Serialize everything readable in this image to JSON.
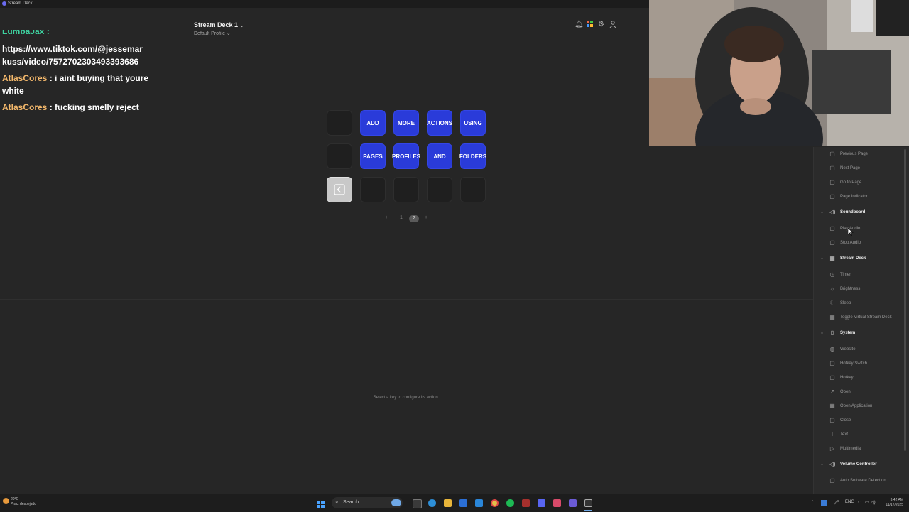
{
  "window": {
    "title": "Stream Deck"
  },
  "chat": {
    "cut_line": "LumbaJax :",
    "link_line1": "https://www.tiktok.com/@jessemar",
    "link_line2": "kuss/video/7572702303493393686",
    "messages": [
      {
        "user": "AtlasCores",
        "sep": " : ",
        "text": "i aint buying that youre",
        "cont": "white"
      },
      {
        "user": "AtlasCores",
        "sep": " : ",
        "text": "fucking smelly reject"
      }
    ]
  },
  "header": {
    "deck_name": "Stream Deck 1",
    "deck_chevron": "⌄",
    "profile": "Default Profile",
    "profile_chevron": "⌄",
    "icons": [
      "bell-icon",
      "marketplace-icon",
      "settings-icon",
      "account-icon"
    ]
  },
  "keys": {
    "row1": [
      "",
      "ADD",
      "MORE",
      "ACTIONS",
      "USING"
    ],
    "row2": [
      "",
      "PAGES",
      "PROFILES",
      "AND",
      "FOLDERS"
    ],
    "row3": [
      "‹",
      "",
      "",
      "",
      ""
    ]
  },
  "pager": {
    "prev": "+",
    "page1": "1",
    "page2": "2",
    "next": "+"
  },
  "hint": "Select a key to configure its action.",
  "sidebar": {
    "items": [
      {
        "type": "item",
        "label": "Previous Page",
        "icon": "previous-page-icon",
        "glyph": "▢"
      },
      {
        "type": "item",
        "label": "Next Page",
        "icon": "next-page-icon",
        "glyph": "▢"
      },
      {
        "type": "item",
        "label": "Go to Page",
        "icon": "go-to-page-icon",
        "glyph": "▢"
      },
      {
        "type": "item",
        "label": "Page Indicator",
        "icon": "page-indicator-icon",
        "glyph": "▢"
      },
      {
        "type": "cat",
        "label": "Soundboard",
        "icon": "soundboard-icon",
        "glyph": "◁)"
      },
      {
        "type": "item",
        "label": "Play Audio",
        "icon": "play-audio-icon",
        "glyph": "▢"
      },
      {
        "type": "item",
        "label": "Stop Audio",
        "icon": "stop-audio-icon",
        "glyph": "▢"
      },
      {
        "type": "cat",
        "label": "Stream Deck",
        "icon": "stream-deck-icon",
        "glyph": "▦"
      },
      {
        "type": "item",
        "label": "Timer",
        "icon": "timer-icon",
        "glyph": "◷"
      },
      {
        "type": "item",
        "label": "Brightness",
        "icon": "brightness-icon",
        "glyph": "☼"
      },
      {
        "type": "item",
        "label": "Sleep",
        "icon": "sleep-icon",
        "glyph": "☾"
      },
      {
        "type": "item",
        "label": "Toggle Virtual Stream Deck",
        "icon": "virtual-deck-icon",
        "glyph": "▦"
      },
      {
        "type": "cat",
        "label": "System",
        "icon": "system-icon",
        "glyph": "▯"
      },
      {
        "type": "item",
        "label": "Website",
        "icon": "website-icon",
        "glyph": "◍"
      },
      {
        "type": "item",
        "label": "Hotkey Switch",
        "icon": "hotkey-switch-icon",
        "glyph": "▢"
      },
      {
        "type": "item",
        "label": "Hotkey",
        "icon": "hotkey-icon",
        "glyph": "▢"
      },
      {
        "type": "item",
        "label": "Open",
        "icon": "open-icon",
        "glyph": "↗"
      },
      {
        "type": "item",
        "label": "Open Application",
        "icon": "open-application-icon",
        "glyph": "▦"
      },
      {
        "type": "item",
        "label": "Close",
        "icon": "close-icon",
        "glyph": "▢"
      },
      {
        "type": "item",
        "label": "Text",
        "icon": "text-icon",
        "glyph": "T"
      },
      {
        "type": "item",
        "label": "Multimedia",
        "icon": "multimedia-icon",
        "glyph": "▷"
      },
      {
        "type": "cat",
        "label": "Volume Controller",
        "icon": "volume-controller-icon",
        "glyph": "◁)"
      },
      {
        "type": "item",
        "label": "Auto Software Detection",
        "icon": "auto-detection-icon",
        "glyph": "▢"
      }
    ]
  },
  "taskbar": {
    "weather_temp": "20°C",
    "weather_desc": "Prac. despejado",
    "search_label": "Search",
    "lang": "ENG",
    "time": "3:42 AM",
    "date": "11/17/2025"
  },
  "colors": {
    "key_blue": "#2a3bd9",
    "chat_user": "#f2b76b",
    "chat_cut": "#3ed2a0"
  }
}
